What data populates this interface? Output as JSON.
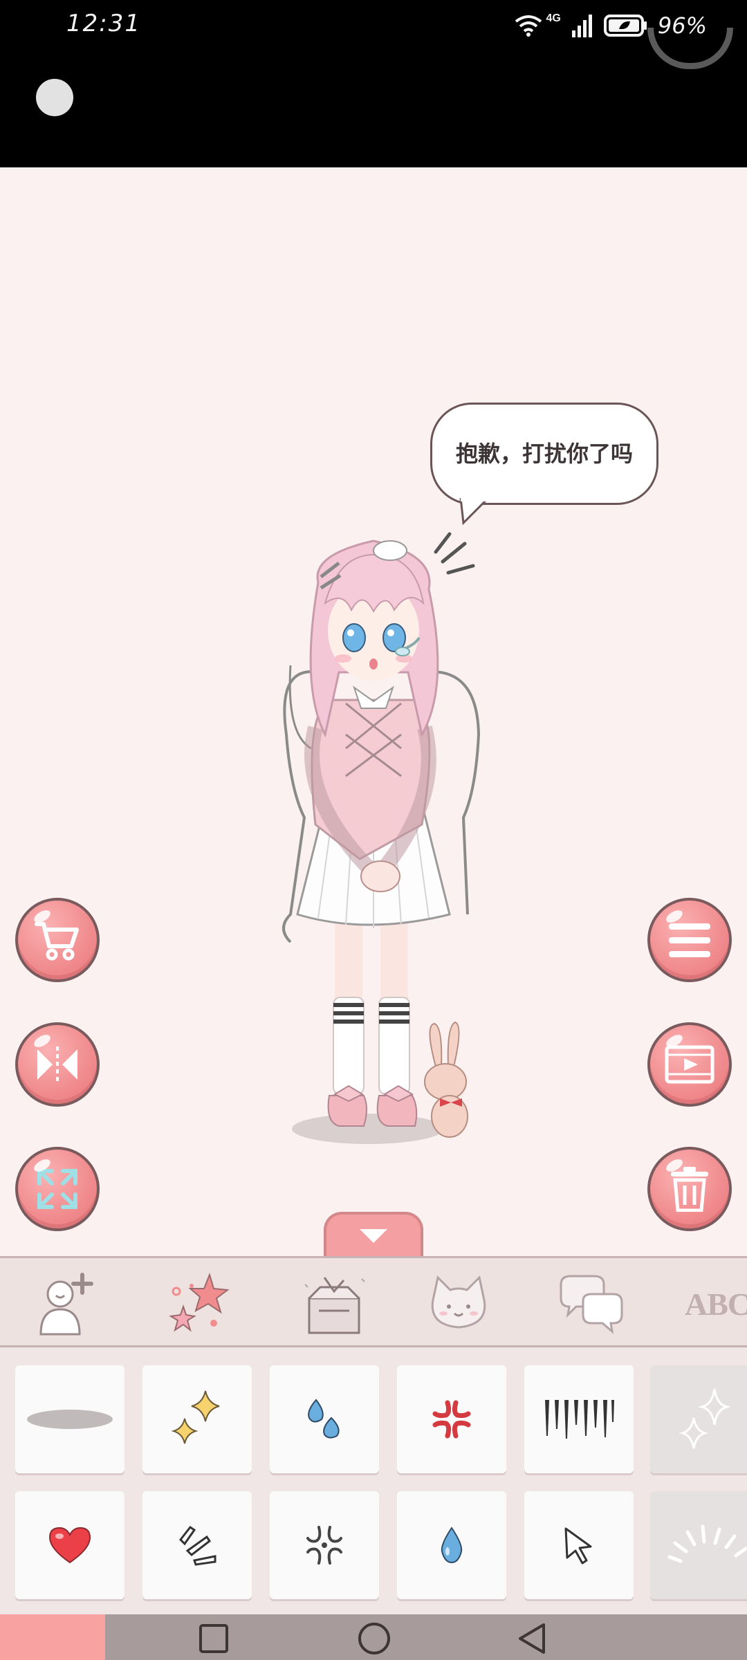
{
  "status_bar": {
    "time": "12:31",
    "network": "4G",
    "battery": "96%"
  },
  "speech_bubble": {
    "text": "抱歉，打扰你了吗"
  },
  "side_buttons": {
    "left": [
      "cart-icon",
      "mirror-flip-icon",
      "expand-icon"
    ],
    "right": [
      "menu-icon",
      "video-icon",
      "trash-icon"
    ]
  },
  "categories": [
    {
      "id": "character",
      "icon": "add-person-icon"
    },
    {
      "id": "effects",
      "icon": "stars-icon"
    },
    {
      "id": "items",
      "icon": "box-icon"
    },
    {
      "id": "pets",
      "icon": "cat-face-icon"
    },
    {
      "id": "speech",
      "icon": "chat-bubbles-icon"
    },
    {
      "id": "text",
      "label": "ABC"
    }
  ],
  "items": [
    {
      "icon": "shadow-icon"
    },
    {
      "icon": "sparkle-icon"
    },
    {
      "icon": "sweat-drops-icon"
    },
    {
      "icon": "anger-mark-icon"
    },
    {
      "icon": "gloom-lines-icon"
    },
    {
      "icon": "sparkle-outline-icon",
      "locked": true
    },
    {
      "icon": "heart-icon"
    },
    {
      "icon": "surprise-lines-icon"
    },
    {
      "icon": "anger-outline-icon"
    },
    {
      "icon": "water-drop-icon"
    },
    {
      "icon": "cursor-arrow-icon"
    },
    {
      "icon": "shine-lines-icon",
      "locked": true
    }
  ],
  "colors": {
    "accent": "#f08b8e",
    "stage_bg": "#faf1f0",
    "panel_bg": "#eee2e1"
  }
}
